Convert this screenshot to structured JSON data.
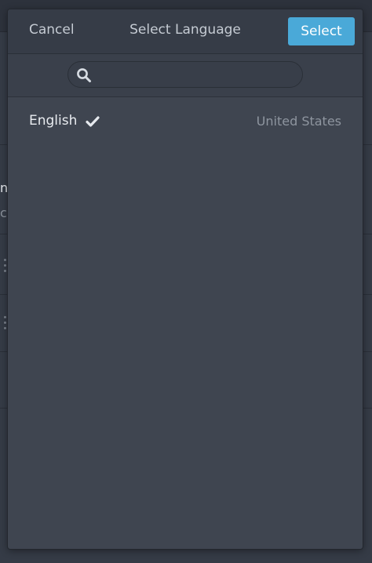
{
  "modal": {
    "title": "Select Language",
    "cancel_label": "Cancel",
    "select_label": "Select",
    "accent_color": "#4aa9d8"
  },
  "search": {
    "placeholder": "",
    "value": "",
    "icon": "search-icon"
  },
  "languages": [
    {
      "label": "English",
      "region": "United States",
      "selected": true,
      "icon": "check-icon"
    }
  ],
  "background": {
    "fragments": [
      "n",
      "ch"
    ]
  }
}
